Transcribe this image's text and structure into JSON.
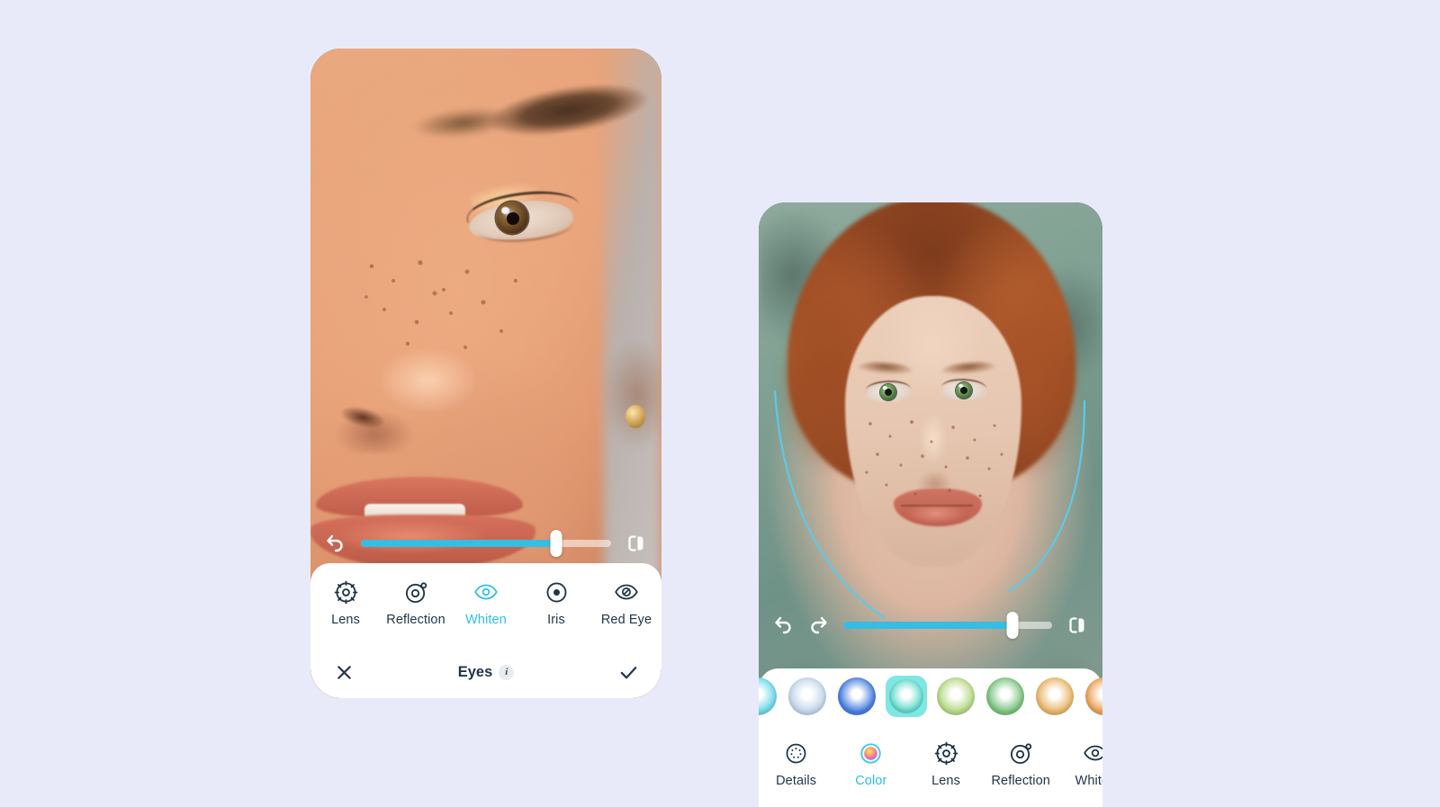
{
  "background_color": "#e8eafa",
  "accent_color": "#2cc0e8",
  "slider_fill_color": "#35bde4",
  "text_color": "#1e3448",
  "left_phone": {
    "name": "eyes-editor-screen",
    "slider": {
      "value_percent": 78,
      "undo_icon": "undo-arrow-icon",
      "compare_icon": "compare-split-icon"
    },
    "tools": [
      {
        "label": "Lens",
        "icon": "lens-icon",
        "active": false
      },
      {
        "label": "Reflection",
        "icon": "reflection-icon",
        "active": false
      },
      {
        "label": "Whiten",
        "icon": "whiten-eye-icon",
        "active": true
      },
      {
        "label": "Iris",
        "icon": "iris-icon",
        "active": false
      },
      {
        "label": "Red Eye",
        "icon": "red-eye-icon",
        "active": false
      }
    ],
    "action_bar": {
      "cancel_icon": "close-x-icon",
      "title": "Eyes",
      "info_glyph": "i",
      "confirm_icon": "check-icon"
    }
  },
  "right_phone": {
    "name": "eye-color-editor-screen",
    "slider": {
      "value_percent": 81,
      "undo_icon": "undo-arrow-icon",
      "redo_icon": "redo-arrow-icon",
      "compare_icon": "compare-split-icon"
    },
    "swatches": [
      {
        "name": "swatch-cyan",
        "color": "#6fd8ea",
        "selected": false
      },
      {
        "name": "swatch-pale-blue",
        "color": "#c3d6ea",
        "selected": false
      },
      {
        "name": "swatch-blue",
        "color": "#4a7fe0",
        "selected": false
      },
      {
        "name": "swatch-teal",
        "color": "#68ddcd",
        "selected": true
      },
      {
        "name": "swatch-light-green",
        "color": "#b6d986",
        "selected": false
      },
      {
        "name": "swatch-green",
        "color": "#7bc47f",
        "selected": false
      },
      {
        "name": "swatch-amber",
        "color": "#e9b76a",
        "selected": false
      },
      {
        "name": "swatch-orange",
        "color": "#e9a35c",
        "selected": false
      }
    ],
    "tools": [
      {
        "label": "Details",
        "icon": "details-icon",
        "active": false
      },
      {
        "label": "Color",
        "icon": "color-wheel-icon",
        "active": true
      },
      {
        "label": "Lens",
        "icon": "lens-icon",
        "active": false
      },
      {
        "label": "Reflection",
        "icon": "reflection-icon",
        "active": false
      },
      {
        "label": "Whiten",
        "icon": "whiten-eye-icon",
        "active": false
      }
    ]
  }
}
